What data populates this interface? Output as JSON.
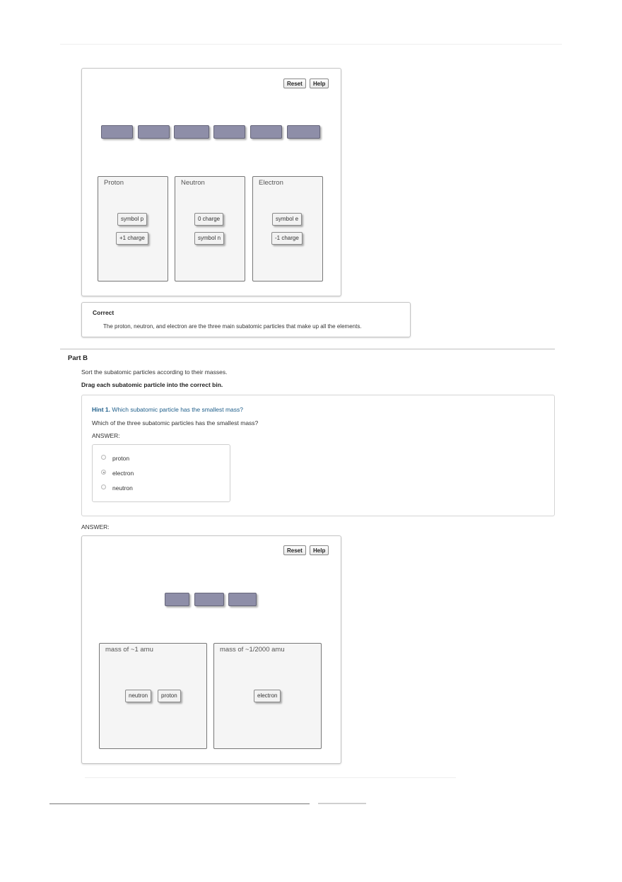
{
  "part_a": {
    "toolbar": {
      "reset_label": "Reset",
      "help_label": "Help"
    },
    "bins": [
      {
        "title": "Proton",
        "chips": [
          "symbol p",
          "+1 charge"
        ]
      },
      {
        "title": "Neutron",
        "chips": [
          "0 charge",
          "symbol n"
        ]
      },
      {
        "title": "Electron",
        "chips": [
          "symbol e",
          "-1 charge"
        ]
      }
    ],
    "feedback": {
      "title": "Correct",
      "message": "The proton, neutron, and electron are the three main subatomic particles that make up all the elements."
    }
  },
  "part_b": {
    "heading": "Part B",
    "instruction": "Sort the subatomic particles according to their masses.",
    "directive": "Drag each subatomic particle into the correct bin.",
    "hint": {
      "number_label": "Hint 1.",
      "title": "Which subatomic particle has the smallest mass?",
      "question": "Which of the three subatomic particles has the smallest mass?",
      "answer_label": "ANSWER:",
      "options": [
        {
          "label": "proton",
          "selected": false
        },
        {
          "label": "electron",
          "selected": true
        },
        {
          "label": "neutron",
          "selected": false
        }
      ]
    },
    "answer_label": "ANSWER:",
    "toolbar": {
      "reset_label": "Reset",
      "help_label": "Help"
    },
    "bins": [
      {
        "title": "mass of ~1 amu",
        "chips": [
          "neutron",
          "proton"
        ]
      },
      {
        "title": "mass of ~1/2000 amu",
        "chips": [
          "electron"
        ]
      }
    ]
  },
  "colors": {
    "slot": "#8e8ea8",
    "hint_link": "#1f5f8b",
    "bin_bg": "#f5f5f5"
  }
}
